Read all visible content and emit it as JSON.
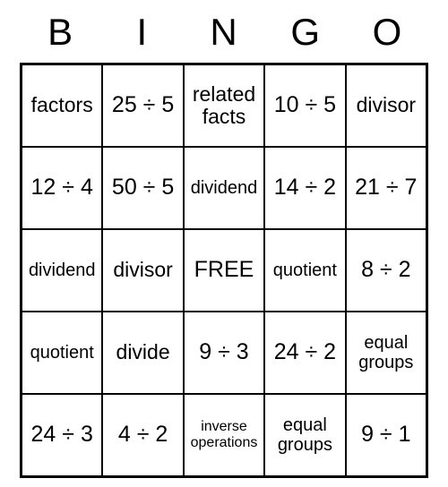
{
  "header": [
    "B",
    "I",
    "N",
    "G",
    "O"
  ],
  "grid": [
    [
      {
        "text": "factors",
        "size": "medium"
      },
      {
        "text": "25 ÷ 5",
        "size": ""
      },
      {
        "text": "related facts",
        "size": "medium"
      },
      {
        "text": "10 ÷ 5",
        "size": ""
      },
      {
        "text": "divisor",
        "size": "medium"
      }
    ],
    [
      {
        "text": "12 ÷ 4",
        "size": ""
      },
      {
        "text": "50 ÷ 5",
        "size": ""
      },
      {
        "text": "dividend",
        "size": "small"
      },
      {
        "text": "14 ÷ 2",
        "size": ""
      },
      {
        "text": "21 ÷ 7",
        "size": ""
      }
    ],
    [
      {
        "text": "dividend",
        "size": "small"
      },
      {
        "text": "divisor",
        "size": "medium"
      },
      {
        "text": "FREE",
        "size": ""
      },
      {
        "text": "quotient",
        "size": "small"
      },
      {
        "text": "8 ÷ 2",
        "size": ""
      }
    ],
    [
      {
        "text": "quotient",
        "size": "small"
      },
      {
        "text": "divide",
        "size": "medium"
      },
      {
        "text": "9 ÷ 3",
        "size": ""
      },
      {
        "text": "24 ÷ 2",
        "size": ""
      },
      {
        "text": "equal groups",
        "size": "small"
      }
    ],
    [
      {
        "text": "24 ÷ 3",
        "size": ""
      },
      {
        "text": "4 ÷ 2",
        "size": ""
      },
      {
        "text": "inverse operations",
        "size": "xsmall"
      },
      {
        "text": "equal groups",
        "size": "small"
      },
      {
        "text": "9 ÷ 1",
        "size": ""
      }
    ]
  ]
}
